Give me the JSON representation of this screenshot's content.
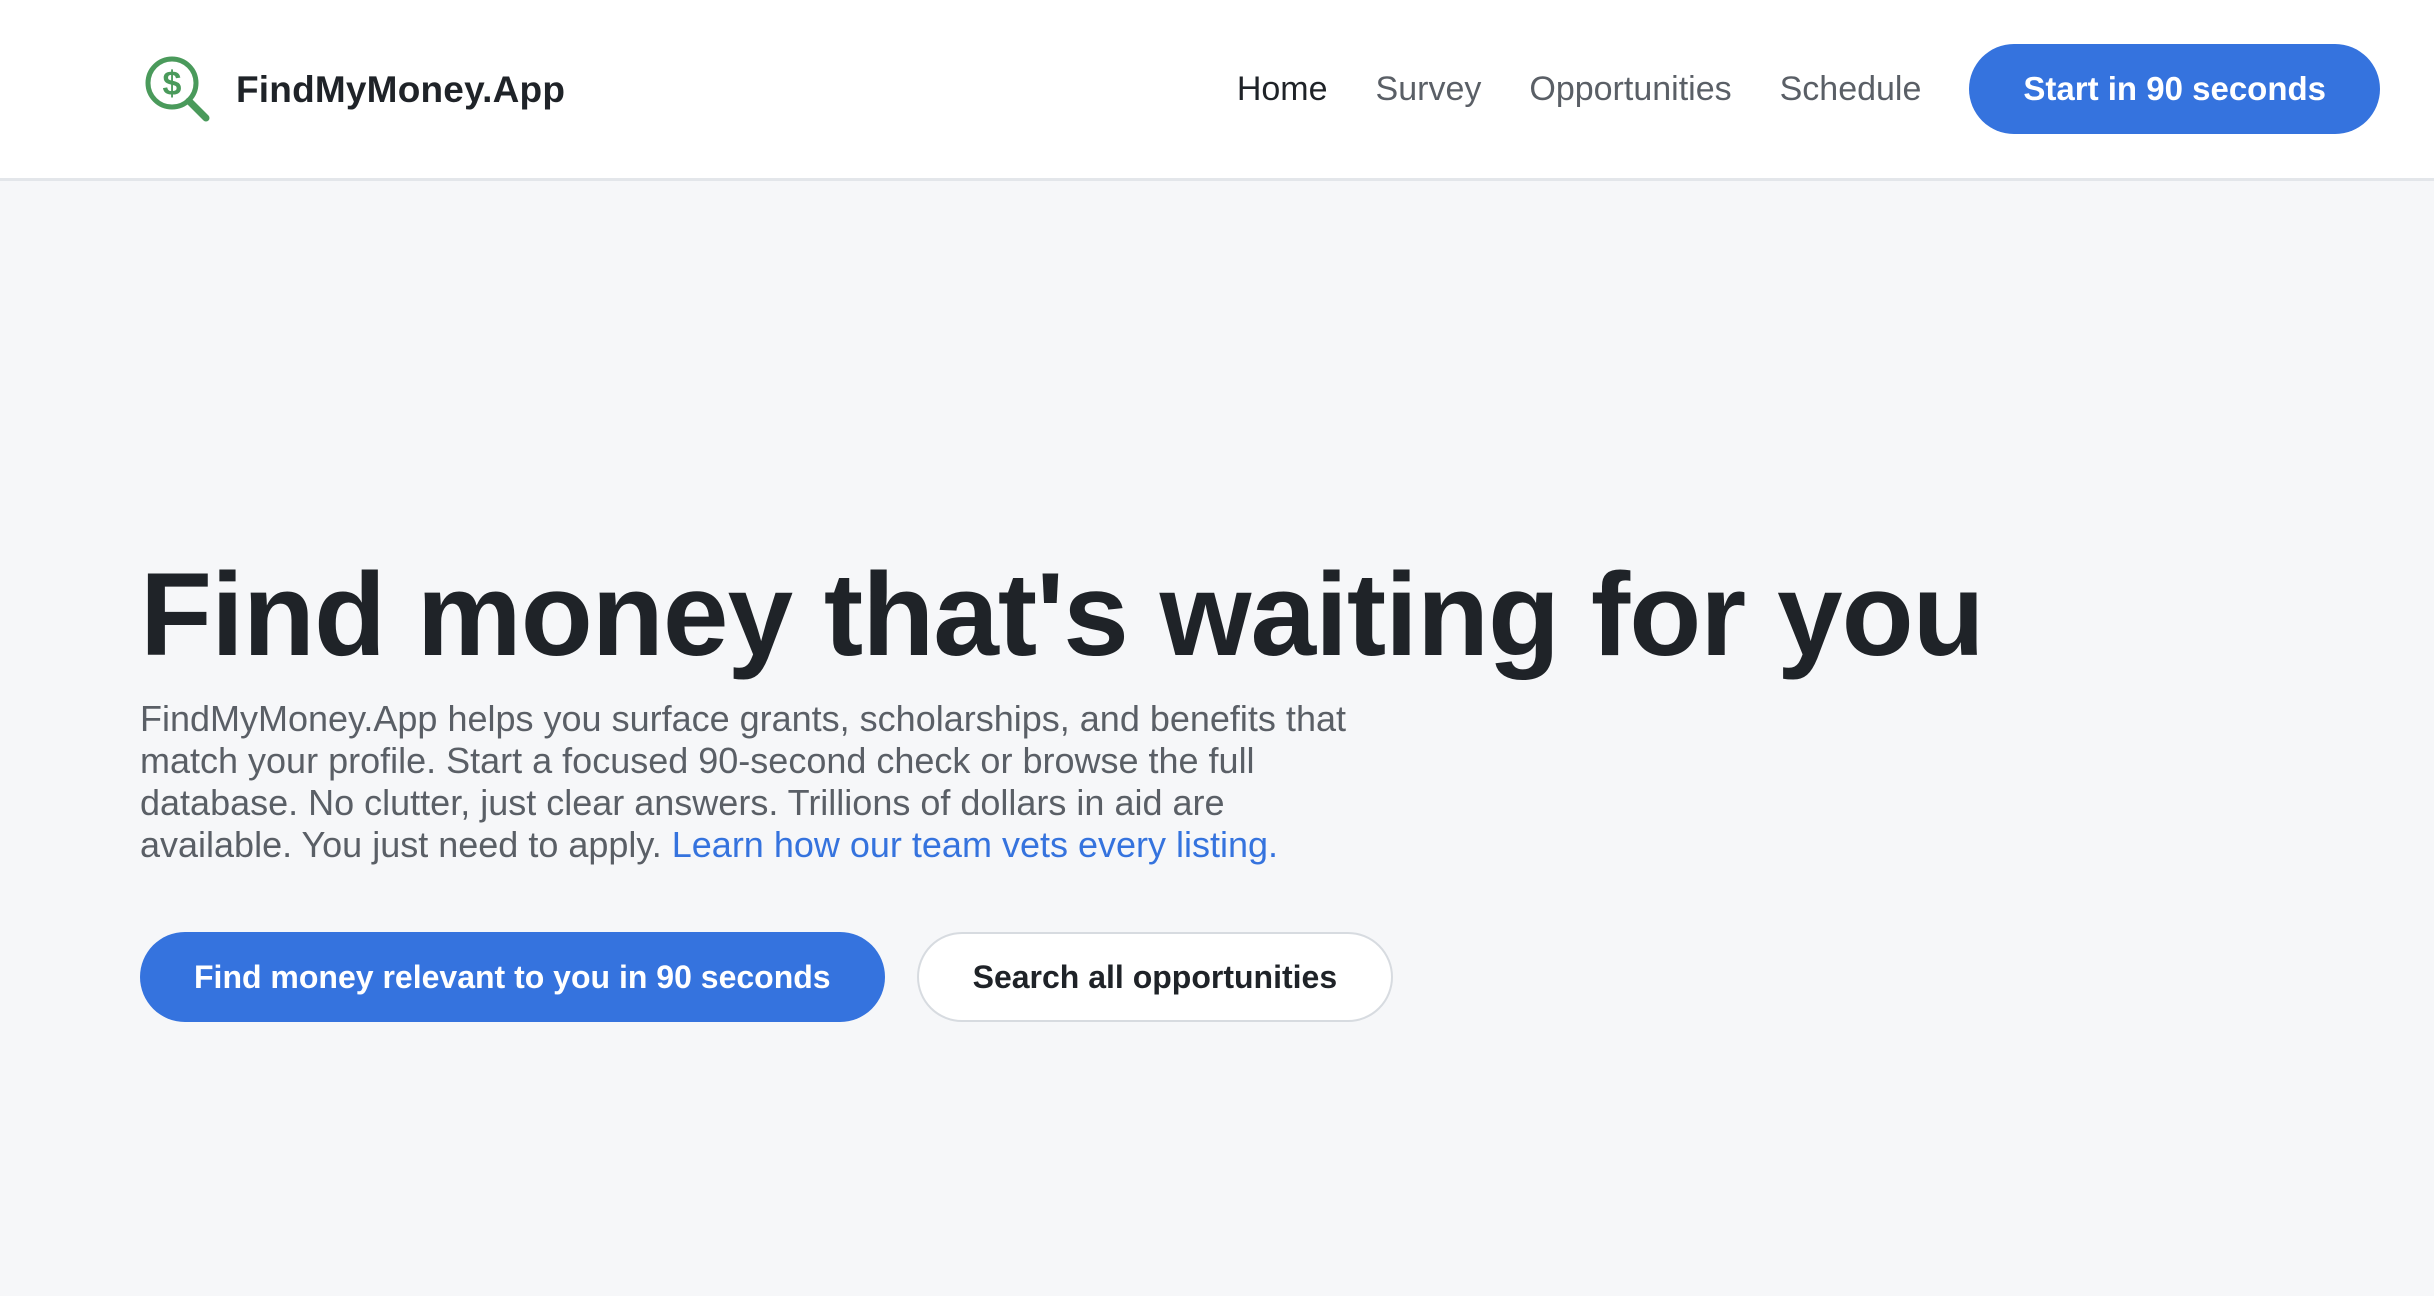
{
  "header": {
    "brand_name": "FindMyMoney.App",
    "logo_icon": "dollar-search-icon",
    "brand_color": "#4a9a5b",
    "nav": [
      {
        "label": "Home",
        "active": true
      },
      {
        "label": "Survey",
        "active": false
      },
      {
        "label": "Opportunities",
        "active": false
      },
      {
        "label": "Schedule",
        "active": false
      }
    ],
    "cta_label": "Start in 90 seconds"
  },
  "hero": {
    "title": "Find money that's waiting for you",
    "description": "FindMyMoney.App helps you surface grants, scholarships, and benefits that match your profile. Start a focused 90-second check or browse the full database. No clutter, just clear answers. Trillions of dollars in aid are available. You just need to apply. ",
    "description_link": "Learn how our team vets every listing.",
    "primary_button": "Find money relevant to you in 90 seconds",
    "secondary_button": "Search all opportunities"
  },
  "colors": {
    "accent": "#3573de",
    "background": "#f6f7f9",
    "text": "#1f2328",
    "muted": "#5a5f66"
  }
}
